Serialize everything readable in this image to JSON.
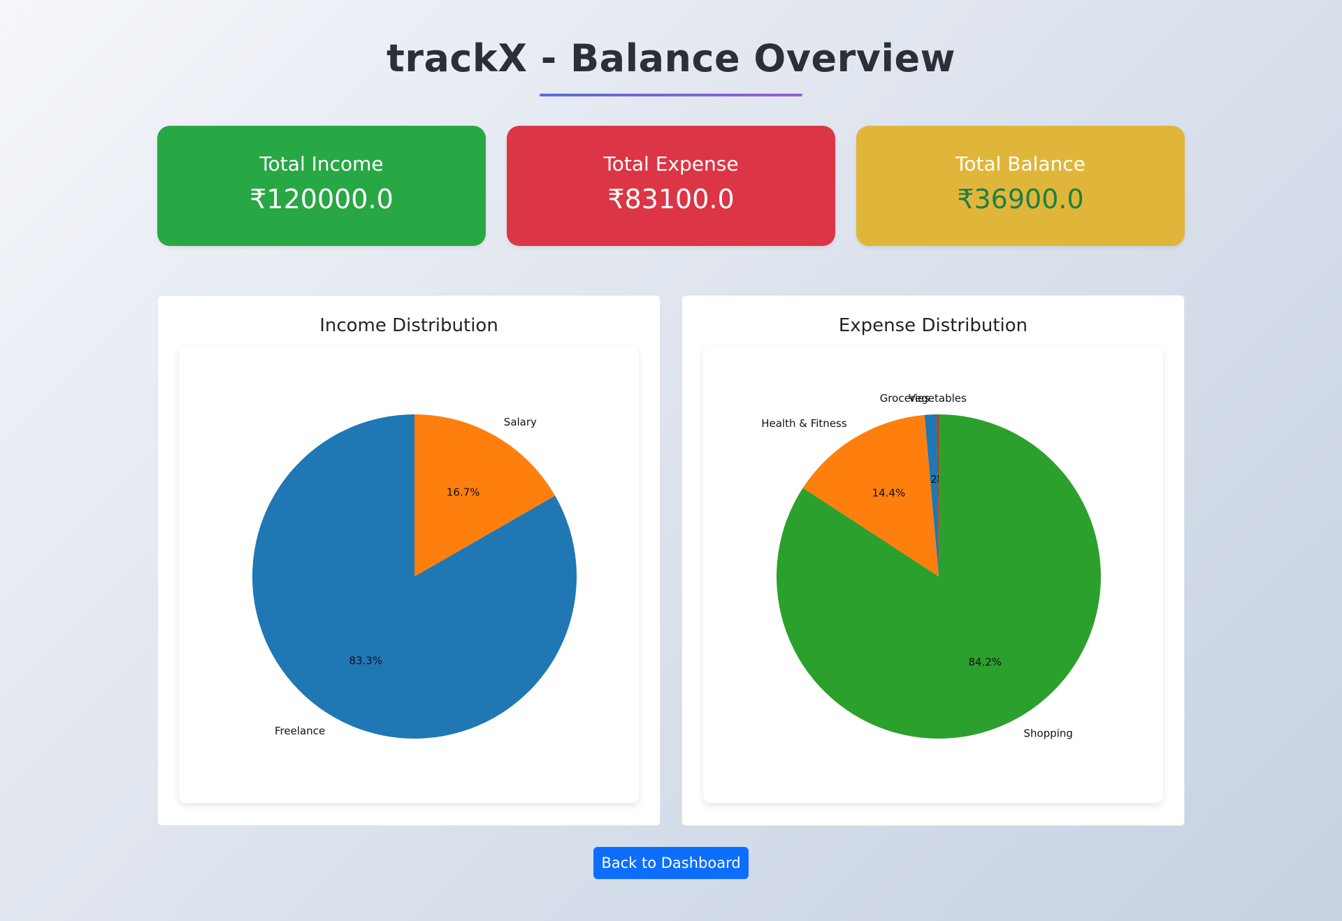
{
  "page": {
    "title": "trackX - Balance Overview"
  },
  "summary": {
    "income": {
      "label": "Total Income",
      "value": "₹120000.0",
      "color": "#28a745"
    },
    "expense": {
      "label": "Total Expense",
      "value": "₹83100.0",
      "color": "#dc3545"
    },
    "balance": {
      "label": "Total Balance",
      "value": "₹36900.0",
      "color": "#e0b63a",
      "value_color": "#1e7e45"
    }
  },
  "chart_data": [
    {
      "type": "pie",
      "title": "Income Distribution",
      "start_angle_deg": 90,
      "direction": "clockwise",
      "slices": [
        {
          "label": "Salary",
          "pct": 16.7,
          "pct_label": "16.7%",
          "color": "#ff7f0e"
        },
        {
          "label": "Freelance",
          "pct": 83.3,
          "pct_label": "83.3%",
          "color": "#1f77b4"
        }
      ]
    },
    {
      "type": "pie",
      "title": "Expense Distribution",
      "start_angle_deg": 90,
      "direction": "counterclockwise",
      "slices": [
        {
          "label": "Vegetables",
          "pct": 0.2,
          "pct_label": "0.2%",
          "color": "#d62728"
        },
        {
          "label": "Groceries",
          "pct": 1.2,
          "pct_label": "1.2%",
          "color": "#1f77b4"
        },
        {
          "label": "Health & Fitness",
          "pct": 14.4,
          "pct_label": "14.4%",
          "color": "#ff7f0e"
        },
        {
          "label": "Shopping",
          "pct": 84.2,
          "pct_label": "84.2%",
          "color": "#2ca02c"
        }
      ]
    }
  ],
  "actions": {
    "back_label": "Back to Dashboard"
  }
}
